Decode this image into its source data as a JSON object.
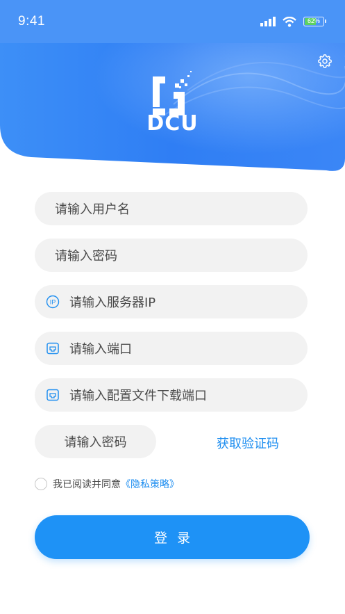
{
  "status_bar": {
    "time": "9:41",
    "battery": "62%"
  },
  "brand": {
    "name": "DCU"
  },
  "form": {
    "username_placeholder": "请输入用户名",
    "password_placeholder": "请输入密码",
    "server_ip_placeholder": "请输入服务器IP",
    "port_placeholder": "请输入端口",
    "config_port_placeholder": "请输入配置文件下载端口",
    "code_placeholder": "请输入密码",
    "get_code_label": "获取验证码"
  },
  "agreement": {
    "text": "我已阅读并同意",
    "policy_link": "《隐私策略》"
  },
  "login_button": "登录",
  "colors": {
    "accent": "#1e92f6",
    "header_start": "#3f8ef6",
    "field_bg": "#f2f2f2"
  }
}
